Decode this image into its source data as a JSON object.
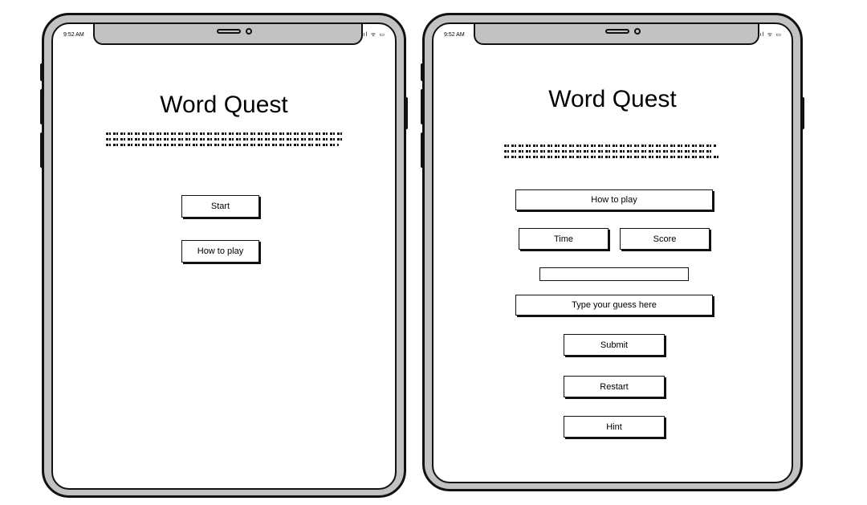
{
  "devices": [
    {
      "status": {
        "time": "9:52 AM",
        "icons": ".ıl ᯤ ▭"
      },
      "title": "Word Quest",
      "buttons": {
        "start": "Start",
        "how_to_play": "How to play"
      }
    },
    {
      "status": {
        "time": "9:52 AM",
        "icons": ".ıl ᯤ ▭"
      },
      "title": "Word Quest",
      "buttons": {
        "how_to_play": "How to play",
        "time": "Time",
        "score": "Score",
        "guess": "Type your guess here",
        "submit": "Submit",
        "restart": "Restart",
        "hint": "Hint"
      }
    }
  ]
}
